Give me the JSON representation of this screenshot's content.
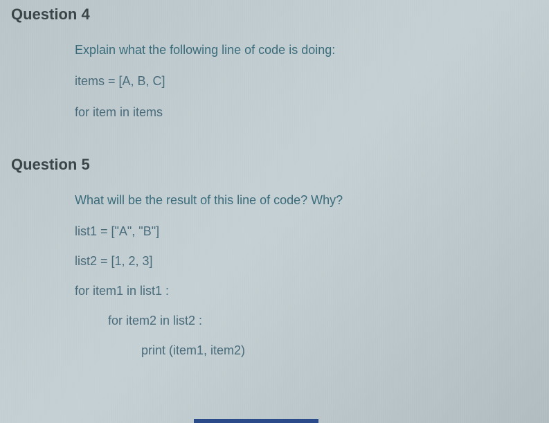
{
  "question4": {
    "heading": "Question 4",
    "prompt": "Explain what the following line of code is doing:",
    "line1": "items = [A, B, C]",
    "line2": "for item in items"
  },
  "question5": {
    "heading": "Question 5",
    "prompt": "What will be the result of this line of code? Why?",
    "line1": "list1 = [\"A\", \"B\"]",
    "line2": "list2 = [1, 2, 3]",
    "line3": "for item1 in list1 :",
    "line4": "for item2 in list2 :",
    "line5": "print (item1, item2)"
  }
}
